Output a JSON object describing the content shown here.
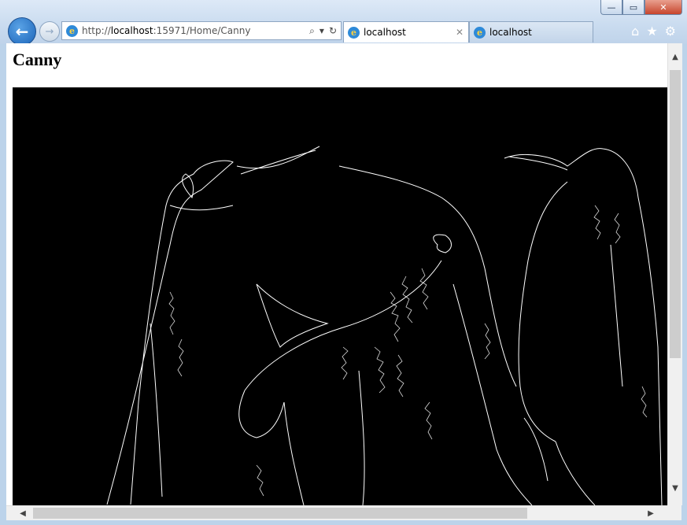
{
  "window": {
    "buttons": {
      "minimize": "—",
      "maximize": "▭",
      "close": "✕"
    }
  },
  "nav": {
    "back_icon": "←",
    "forward_icon": "→"
  },
  "address_bar": {
    "protocol": "http://",
    "host": "localhost",
    "path": ":15971/Home/Canny",
    "search_icon": "⌕",
    "dropdown_icon": "▾",
    "refresh_icon": "↻"
  },
  "tabs": [
    {
      "label": "localhost",
      "close": "✕"
    },
    {
      "label": "localhost"
    }
  ],
  "toolbar_icons": {
    "home": "⌂",
    "favorites": "★",
    "settings": "⚙"
  },
  "page": {
    "heading": "Canny"
  },
  "scrollbars": {
    "up": "▲",
    "down": "▼",
    "left": "◀",
    "right": "▶"
  }
}
